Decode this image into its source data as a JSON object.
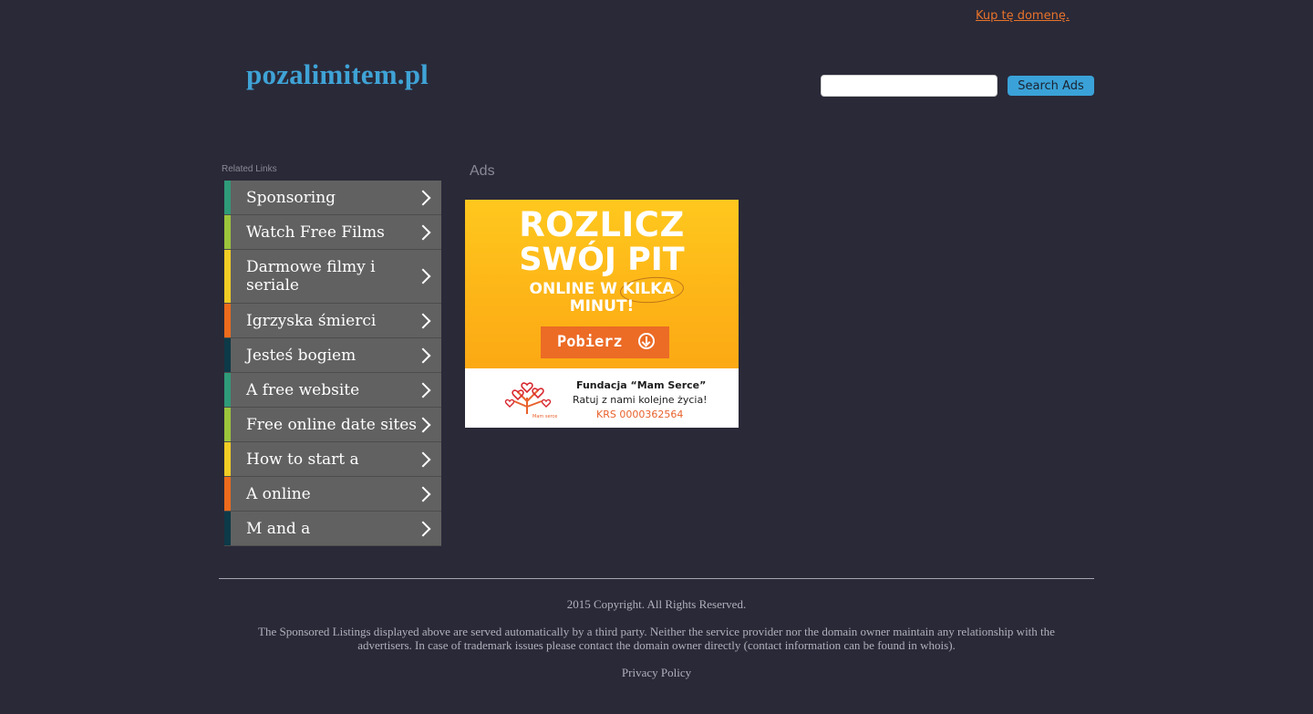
{
  "header": {
    "buy_domain_link": "Kup tę domenę.",
    "site_title": "pozalimitem.pl",
    "search": {
      "placeholder": "",
      "value": "",
      "button_label": "Search Ads"
    }
  },
  "related": {
    "title": "Related Links",
    "items": [
      {
        "label": "Sponsoring",
        "color": "#2f9b78"
      },
      {
        "label": "Watch Free Films",
        "color": "#9cc53c"
      },
      {
        "label": "Darmowe filmy i seriale",
        "color": "#f0cc24"
      },
      {
        "label": "Igrzyska śmierci",
        "color": "#ec6b1d"
      },
      {
        "label": "Jesteś bogiem",
        "color": "#0d3a48"
      },
      {
        "label": "A free website",
        "color": "#2f9b78"
      },
      {
        "label": "Free online date sites",
        "color": "#9cc53c"
      },
      {
        "label": "How to start a",
        "color": "#f0cc24"
      },
      {
        "label": "A online",
        "color": "#ec6b1d"
      },
      {
        "label": "M and a",
        "color": "#0d3a48"
      }
    ]
  },
  "ads": {
    "title": "Ads",
    "banner": {
      "line1": "ROZLICZ",
      "line2": "SWÓJ PIT",
      "line3": "ONLINE W KILKA MINUT!",
      "cta": "Pobierz",
      "org": "Fundacja “Mam Serce”",
      "tagline": "Ratuj z nami kolejne życia!",
      "krs": "KRS 0000362564",
      "logo_caption": "Mam serce"
    }
  },
  "footer": {
    "copyright": "2015 Copyright. All Rights Reserved.",
    "disclaimer": "The Sponsored Listings displayed above are served automatically by a third party. Neither the service provider nor the domain owner maintain any relationship with the advertisers. In case of trademark issues please contact the domain owner directly (contact information can be found in whois).",
    "privacy": "Privacy Policy"
  },
  "colors": {
    "background": "#2a2938",
    "title": "#3fa3d6",
    "buy_link": "#e8732b",
    "search_button": "#3aa2d8",
    "link_bg": "#616161"
  }
}
